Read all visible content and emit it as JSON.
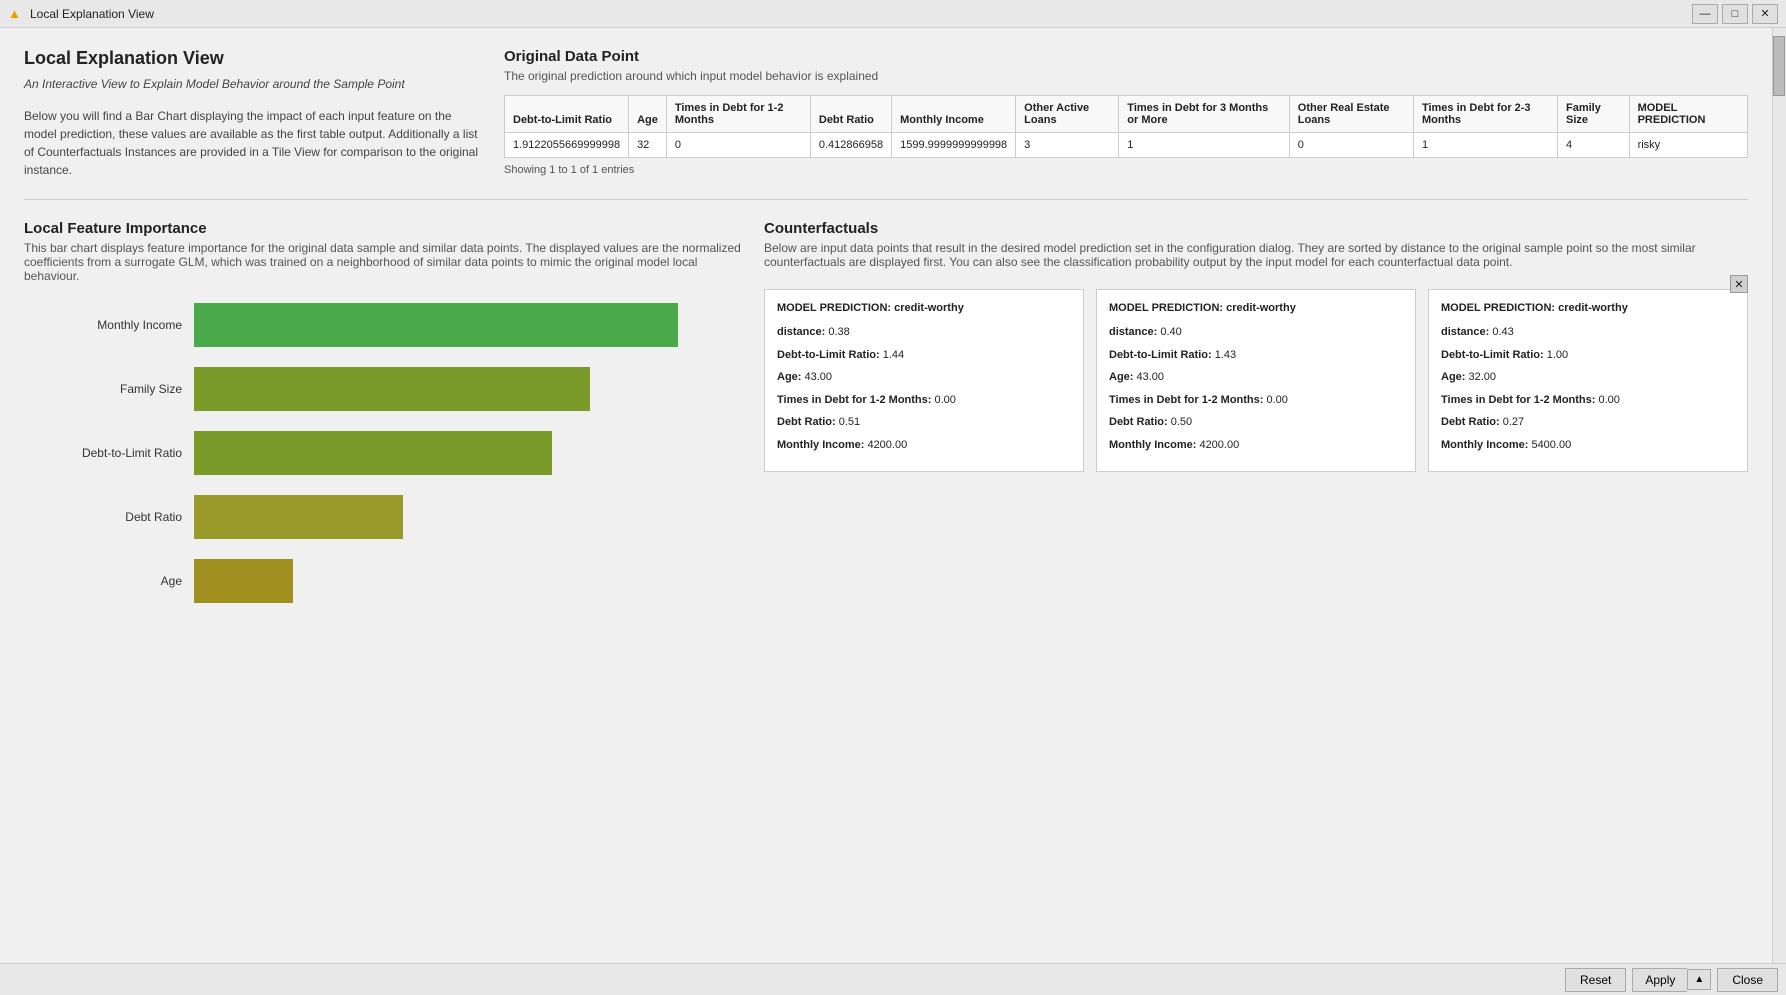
{
  "window": {
    "title": "Local Explanation View",
    "icon": "▲"
  },
  "titlebar_controls": {
    "minimize": "—",
    "maximize": "□",
    "close": "✕"
  },
  "left_panel": {
    "heading": "Local Explanation View",
    "italic_desc": "An Interactive View to Explain Model Behavior around the Sample Point",
    "desc": "Below you will find a Bar Chart displaying the impact of each input feature on the model prediction, these values are available as the first table output. Additionally a list of Counterfactuals Instances are provided in a Tile View for comparison to the original instance."
  },
  "original_data_point": {
    "title": "Original Data Point",
    "desc": "The original prediction around which input model behavior is explained",
    "table": {
      "headers": [
        "Debt-to-Limit Ratio",
        "Age",
        "Times in Debt for 1-2 Months",
        "Debt Ratio",
        "Monthly Income",
        "Other Active Loans",
        "Times in Debt for 3 Months or More",
        "Other Real Estate Loans",
        "Times in Debt for 2-3 Months",
        "Family Size",
        "MODEL PREDICTION"
      ],
      "row": [
        "1.9122055669999998",
        "32",
        "0",
        "0.412866958",
        "1599.9999999999998",
        "3",
        "1",
        "0",
        "1",
        "4",
        "risky"
      ]
    },
    "table_note": "Showing 1 to 1 of 1 entries"
  },
  "feature_importance": {
    "title": "Local Feature Importance",
    "desc": "This bar chart displays feature importance for the original data sample and similar data points. The displayed values are the normalized coefficients from a surrogate GLM, which was trained on a neighborhood of similar data points to mimic the original model local behaviour.",
    "bars": [
      {
        "label": "Monthly Income",
        "width_pct": 88,
        "color": "#4aaa4a"
      },
      {
        "label": "Family Size",
        "width_pct": 72,
        "color": "#7a9a2a"
      },
      {
        "label": "Debt-to-Limit Ratio",
        "width_pct": 65,
        "color": "#7a9a2a"
      },
      {
        "label": "Debt Ratio",
        "width_pct": 38,
        "color": "#9a9a2a"
      },
      {
        "label": "Age",
        "width_pct": 18,
        "color": "#a09020"
      }
    ]
  },
  "counterfactuals": {
    "title": "Counterfactuals",
    "desc": "Below are input data points that result in the desired model prediction set in the configuration dialog. They are sorted by distance to the original sample point so the most similar counterfactuals are displayed first. You can also see the classification probability output by the input model for each counterfactual data point.",
    "cards": [
      {
        "model_pred_label": "MODEL PREDICTION:",
        "model_pred_value": "credit-worthy",
        "fields": [
          {
            "label": "distance:",
            "value": "0.38",
            "bold_label": false
          },
          {
            "label": "Debt-to-Limit Ratio:",
            "value": "1.44"
          },
          {
            "label": "Age:",
            "value": "43.00"
          },
          {
            "label": "Times in Debt for 1-2 Months:",
            "value": "0.00"
          },
          {
            "label": "Debt Ratio:",
            "value": "0.51"
          },
          {
            "label": "Monthly Income:",
            "value": "4200.00"
          }
        ]
      },
      {
        "model_pred_label": "MODEL PREDICTION:",
        "model_pred_value": "credit-worthy",
        "fields": [
          {
            "label": "distance:",
            "value": "0.40"
          },
          {
            "label": "Debt-to-Limit Ratio:",
            "value": "1.43"
          },
          {
            "label": "Age:",
            "value": "43.00"
          },
          {
            "label": "Times in Debt for 1-2 Months:",
            "value": "0.00"
          },
          {
            "label": "Debt Ratio:",
            "value": "0.50"
          },
          {
            "label": "Monthly Income:",
            "value": "4200.00"
          }
        ]
      },
      {
        "model_pred_label": "MODEL PREDICTION:",
        "model_pred_value": "credit-worthy",
        "fields": [
          {
            "label": "distance:",
            "value": "0.43"
          },
          {
            "label": "Debt-to-Limit Ratio:",
            "value": "1.00"
          },
          {
            "label": "Age:",
            "value": "32.00"
          },
          {
            "label": "Times in Debt for 1-2 Months:",
            "value": "0.00"
          },
          {
            "label": "Debt Ratio:",
            "value": "0.27"
          },
          {
            "label": "Monthly Income:",
            "value": "5400.00"
          }
        ]
      }
    ]
  },
  "bottom_bar": {
    "reset_label": "Reset",
    "apply_label": "Apply",
    "close_label": "Close"
  }
}
